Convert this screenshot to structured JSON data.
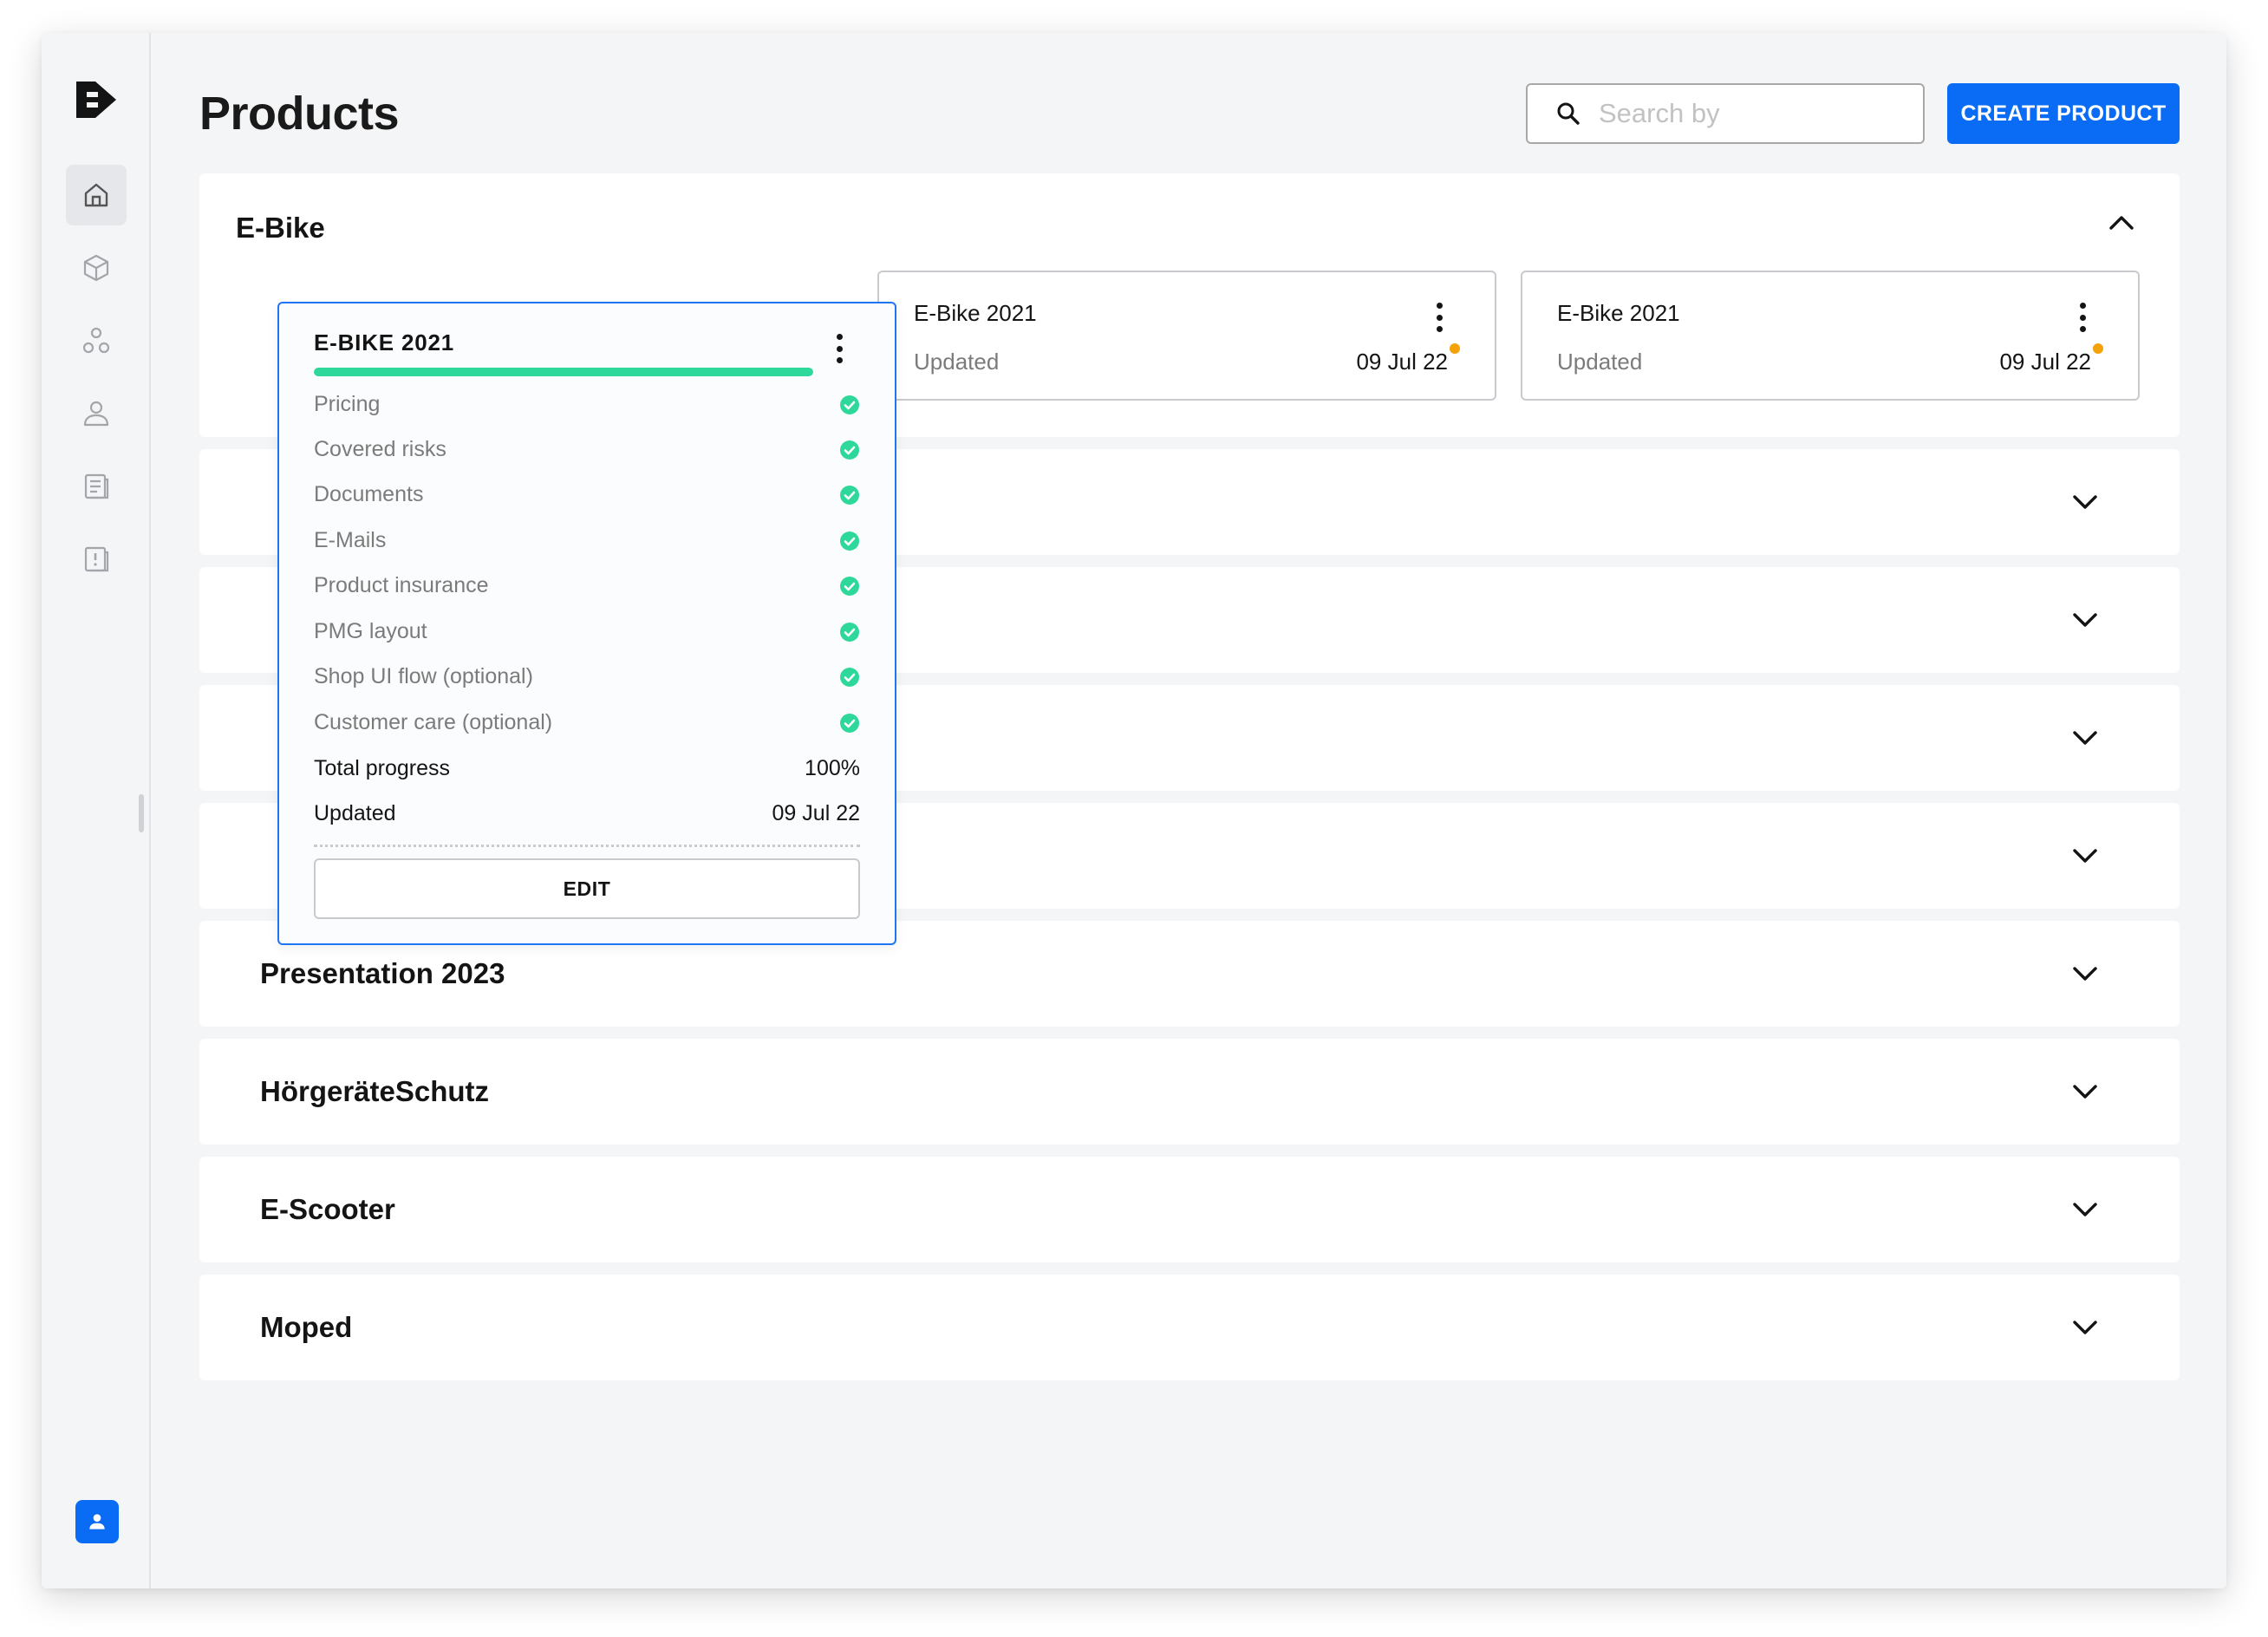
{
  "sidebar": {
    "items": [
      {
        "icon": "home-icon"
      },
      {
        "icon": "cube-icon"
      },
      {
        "icon": "group-icon"
      },
      {
        "icon": "user-icon"
      },
      {
        "icon": "document-list-icon"
      },
      {
        "icon": "alert-document-icon"
      }
    ],
    "user_icon": "user-avatar-icon"
  },
  "header": {
    "title": "Products",
    "search_placeholder": "Search by",
    "create_button": "CREATE PRODUCT"
  },
  "groups": [
    {
      "title": "E-Bike",
      "expanded": true,
      "cards": [
        {
          "title": "E-BIKE 2021",
          "progress_fraction": 1.0,
          "checklist": [
            {
              "label": "Pricing",
              "done": true
            },
            {
              "label": "Covered risks",
              "done": true
            },
            {
              "label": "Documents",
              "done": true
            },
            {
              "label": "E-Mails",
              "done": true
            },
            {
              "label": "Product insurance",
              "done": true
            },
            {
              "label": "PMG layout",
              "done": true
            },
            {
              "label": "Shop UI flow (optional)",
              "done": true
            },
            {
              "label": "Customer  care (optional)",
              "done": true
            }
          ],
          "total_progress_label": "Total progress",
          "total_progress_value": "100%",
          "updated_label": "Updated",
          "updated_date": "09 Jul 22",
          "edit_button": "EDIT"
        },
        {
          "title": "E-Bike 2021",
          "updated_label": "Updated",
          "updated_date": "09 Jul 22",
          "status_dot_color": "#F5A10A"
        },
        {
          "title": "E-Bike 2021",
          "updated_label": "Updated",
          "updated_date": "09 Jul 22",
          "status_dot_color": "#F5A10A"
        }
      ]
    },
    {
      "title": "",
      "expanded": false
    },
    {
      "title": "",
      "expanded": false
    },
    {
      "title": "",
      "expanded": false
    },
    {
      "title": "",
      "expanded": false
    },
    {
      "title": "Presentation 2023",
      "expanded": false
    },
    {
      "title": "HörgeräteSchutz",
      "expanded": false
    },
    {
      "title": "E-Scooter",
      "expanded": false
    },
    {
      "title": "Moped",
      "expanded": false
    }
  ],
  "colors": {
    "accent": "#0A6CF5",
    "progress": "#2ED89A",
    "check": "#2ED89A",
    "status_dot": "#F5A10A"
  }
}
